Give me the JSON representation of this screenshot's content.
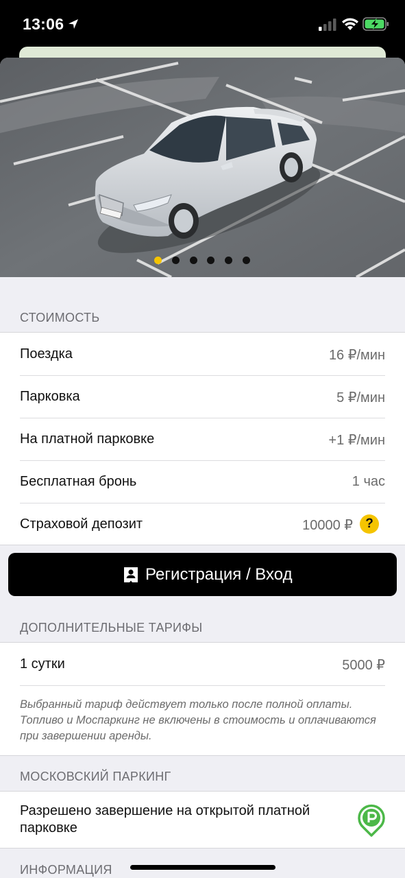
{
  "status_bar": {
    "time": "13:06"
  },
  "gallery": {
    "photo_count": 6,
    "active_index": 0,
    "accent": "#f5c400"
  },
  "pricing": {
    "header": "СТОИМОСТЬ",
    "rows": [
      {
        "label": "Поездка",
        "value": "16 ₽/мин"
      },
      {
        "label": "Парковка",
        "value": "5 ₽/мин"
      },
      {
        "label": "На платной парковке",
        "value": "+1 ₽/мин"
      },
      {
        "label": "Бесплатная бронь",
        "value": "1 час"
      },
      {
        "label": "Страховой депозит",
        "value": "10000 ₽",
        "help": "?"
      }
    ]
  },
  "login_button": {
    "label": "Регистрация / Вход",
    "icon": "contact-card-icon"
  },
  "extra_tariffs": {
    "header": "ДОПОЛНИТЕЛЬНЫЕ ТАРИФЫ",
    "rows": [
      {
        "label": "1 сутки",
        "value": "5000 ₽"
      }
    ],
    "note": "Выбранный тариф действует только после полной оплаты. Топливо и Моспаркинг не включены в стоимость и оплачиваются при завершении аренды."
  },
  "moscow_parking": {
    "header": "МОСКОВСКИЙ ПАРКИНГ",
    "text": "Разрешено завершение на открытой платной парковке",
    "icon": "parking-pin-icon",
    "icon_color": "#4cb848"
  },
  "info": {
    "header": "ИНФОРМАЦИЯ"
  }
}
